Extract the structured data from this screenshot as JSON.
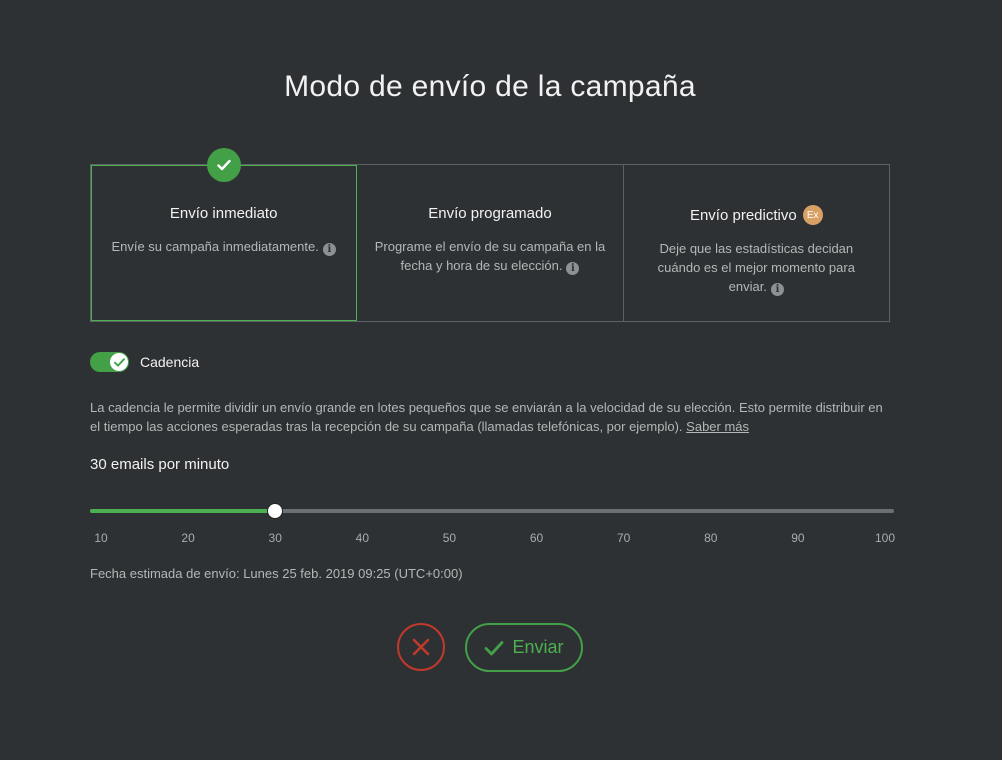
{
  "title": "Modo de envío de la campaña",
  "options": [
    {
      "title": "Envío inmediato",
      "description": "Envíe su campaña inmediatamente.",
      "selected": true
    },
    {
      "title": "Envío programado",
      "description": "Programe el envío de su campaña en la fecha y hora de su elección.",
      "selected": false
    },
    {
      "title": "Envío predictivo",
      "badge": "Ex",
      "description": "Deje que las estadísticas decidan cuándo es el mejor momento para enviar.",
      "selected": false
    }
  ],
  "icons": {
    "selected_check": "check-icon",
    "info": "info-icon",
    "cancel": "close-icon",
    "send": "check-icon"
  },
  "info_glyph": "i",
  "cadence": {
    "label": "Cadencia",
    "enabled": true,
    "description": "La cadencia le permite dividir un envío grande en lotes pequeños que se enviarán a la velocidad de su elección. Esto permite distribuir en el tiempo las acciones esperadas tras la recepción de su campaña (llamadas telefónicas, por ejemplo).",
    "learn_more": "Saber más",
    "rate_label": "30 emails por minuto",
    "slider": {
      "min": 10,
      "max": 100,
      "value": 30,
      "ticks": [
        "10",
        "20",
        "30",
        "40",
        "50",
        "60",
        "70",
        "80",
        "90",
        "100"
      ]
    },
    "estimate": "Fecha estimada de envío: Lunes 25 feb. 2019 09:25 (UTC+0:00)"
  },
  "actions": {
    "send_label": "Enviar"
  },
  "colors": {
    "background": "#2e3133",
    "accent_green": "#43a047",
    "cancel_red": "#c0392b",
    "badge_orange": "#d9a066"
  }
}
